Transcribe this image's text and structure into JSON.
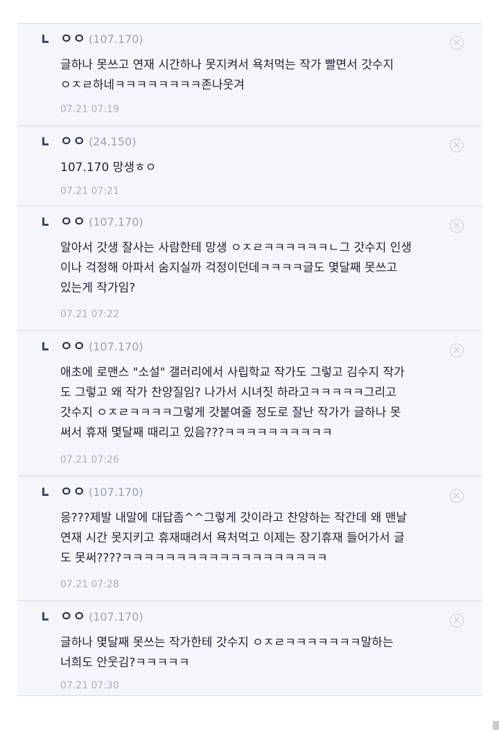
{
  "comments": [
    {
      "nick": "ㅇㅇ",
      "ip": "(107.170)",
      "lines": [
        "글하나 못쓰고 연재 시간하나 못지켜서 욕처먹는 작가 빨면서 갓수지",
        "ㅇㅈㄹ하네ㅋㅋㅋㅋㅋㅋㅋㅋ존나웃겨"
      ],
      "time": "07.21 07:19"
    },
    {
      "nick": "ㅇㅇ",
      "ip": "(24.150)",
      "lines": [
        "107.170 망생ㅎㅇ"
      ],
      "time": "07.21 07:21"
    },
    {
      "nick": "ㅇㅇ",
      "ip": "(107.170)",
      "lines": [
        "알아서 갓생 잘사는 사람한테 망생 ㅇㅈㄹㅋㅋㅋㅋㅋㅋㄴ그 갓수지 인생",
        "이나 걱정해 아파서 숨지실까 걱정이던데ㅋㅋㅋㅋ글도 몇달째 못쓰고",
        "있는게 작가임?"
      ],
      "time": "07.21 07:22"
    },
    {
      "nick": "ㅇㅇ",
      "ip": "(107.170)",
      "lines": [
        "애초에 로맨스 \"소설\" 갤러리에서 사립학교 작가도 그렇고 김수지 작가",
        "도 그렇고 왜 작가 찬양질임? 나가서 시녀짓 하라고ㅋㅋㅋㅋㅋ그리고",
        "갓수지 ㅇㅈㄹㅋㅋㅋㅋ그렇게 갓붙여줄 정도로 잘난 작가가 글하나 못",
        "써서 휴재 몇달째 때리고 있음???ㅋㅋㅋㅋㅋㅋㅋㅋㅋㅋ"
      ],
      "time": "07.21 07:26"
    },
    {
      "nick": "ㅇㅇ",
      "ip": "(107.170)",
      "lines": [
        "응???제발 내말에 대답좀^^그렇게 갓이라고 찬양하는 작간데 왜 맨날",
        "연재 시간 못지키고 휴재때려서 욕처먹고 이제는 장기휴재 들어가서 글",
        "도 못써????ㅋㅋㅋㅋㅋㅋㅋㅋㅋㅋㅋㅋㅋㅋㅋㅋㅋㅋㅋ"
      ],
      "time": "07.21 07:28"
    },
    {
      "nick": "ㅇㅇ",
      "ip": "(107.170)",
      "lines": [
        "글하나 몇달째 못쓰는 작가한테 갓수지 ㅇㅈㄹㅋㅋㅋㅋㅋㅋㅋ말하는",
        "너희도 안웃김?ㅋㅋㅋㅋㅋ"
      ],
      "time": "07.21 07:30"
    }
  ],
  "delete_icon": "close-circle-icon",
  "delete_glyph": "×",
  "reply_icon": "reply-arrow-icon"
}
